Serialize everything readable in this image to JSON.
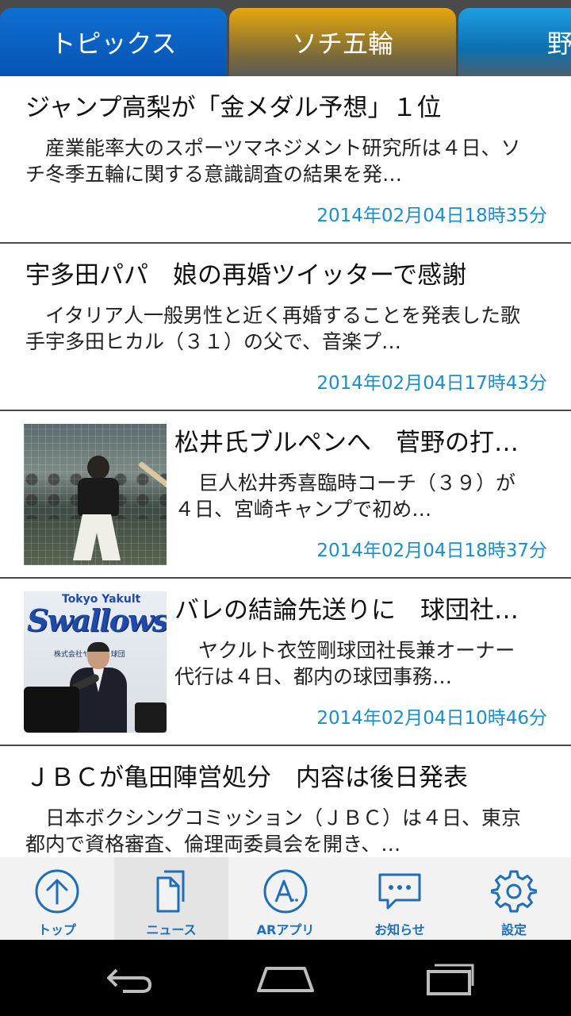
{
  "tabs": [
    {
      "label": "トピックス"
    },
    {
      "label": "ソチ五輪"
    },
    {
      "label": "野"
    }
  ],
  "news": [
    {
      "title": "ジャンプ高梨が「金メダル予想」１位",
      "summary": "産業能率大のスポーツマネジメント研究所は４日、ソチ冬季五輪に関する意識調査の結果を発…",
      "time": "2014年02月04日18時35分"
    },
    {
      "title": "宇多田パパ　娘の再婚ツイッターで感謝",
      "summary": "イタリア人一般男性と近く再婚することを発表した歌手宇多田ヒカル（３１）の父で、音楽プ…",
      "time": "2014年02月04日17時43分"
    },
    {
      "title": "松井氏ブルペンへ　菅野の打…",
      "summary": "巨人松井秀喜臨時コーチ（３９）が４日、宮崎キャンプで初め…",
      "time": "2014年02月04日18時37分",
      "image": "batting-practice-photo"
    },
    {
      "title": "バレの結論先送りに　球団社…",
      "summary": "ヤクルト衣笠剛球団社長兼オーナー代行は４日、都内の球団事務…",
      "time": "2014年02月04日10時46分",
      "image": "press-conference-photo",
      "image_text": {
        "top": "Tokyo Yakult",
        "logo": "Swallows",
        "sub": "株式会社ヤクルト球団"
      }
    },
    {
      "title": "ＪＢＣが亀田陣営処分　内容は後日発表",
      "summary": "日本ボクシングコミッション（ＪＢＣ）は４日、東京都内で資格審査、倫理両委員会を開き、…",
      "time": ""
    }
  ],
  "bottom_nav": [
    {
      "label": "トップ",
      "icon": "arrow-up-circle-icon"
    },
    {
      "label": "ニュース",
      "icon": "documents-icon"
    },
    {
      "label": "ARアプリ",
      "icon": "ar-circle-icon"
    },
    {
      "label": "お知らせ",
      "icon": "chat-bubble-icon"
    },
    {
      "label": "設定",
      "icon": "gear-icon"
    }
  ],
  "colors": {
    "tab_active": "#0654b4",
    "tab_sochi": "#e6a80a",
    "accent": "#1f6fb8",
    "time_text": "#1a8fc7"
  }
}
